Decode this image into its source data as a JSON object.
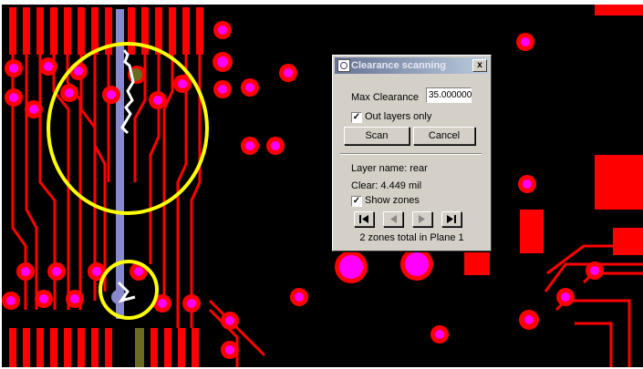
{
  "dialog": {
    "title": "Clearance scanning",
    "close_label": "x",
    "max_clearance_label": "Max Clearance",
    "max_clearance_value": "35.000000",
    "out_layers_only_label": "Out layers only",
    "out_layers_only_checked": true,
    "scan_label": "Scan",
    "cancel_label": "Cancel",
    "layer_name": "Layer name: rear",
    "clear_value": "Clear: 4.449 mil",
    "show_zones_label": "Show zones",
    "show_zones_checked": true,
    "zones_total": "2 zones total in Plane 1",
    "nav_buttons": [
      "first-icon",
      "prev-icon",
      "next-icon",
      "last-icon"
    ]
  },
  "colors": {
    "board_bg": "#000000",
    "trace": "#ff0000",
    "via": "#ff00ff",
    "highlight_circle": "#ffff00",
    "selected_net": "#8888cc"
  }
}
